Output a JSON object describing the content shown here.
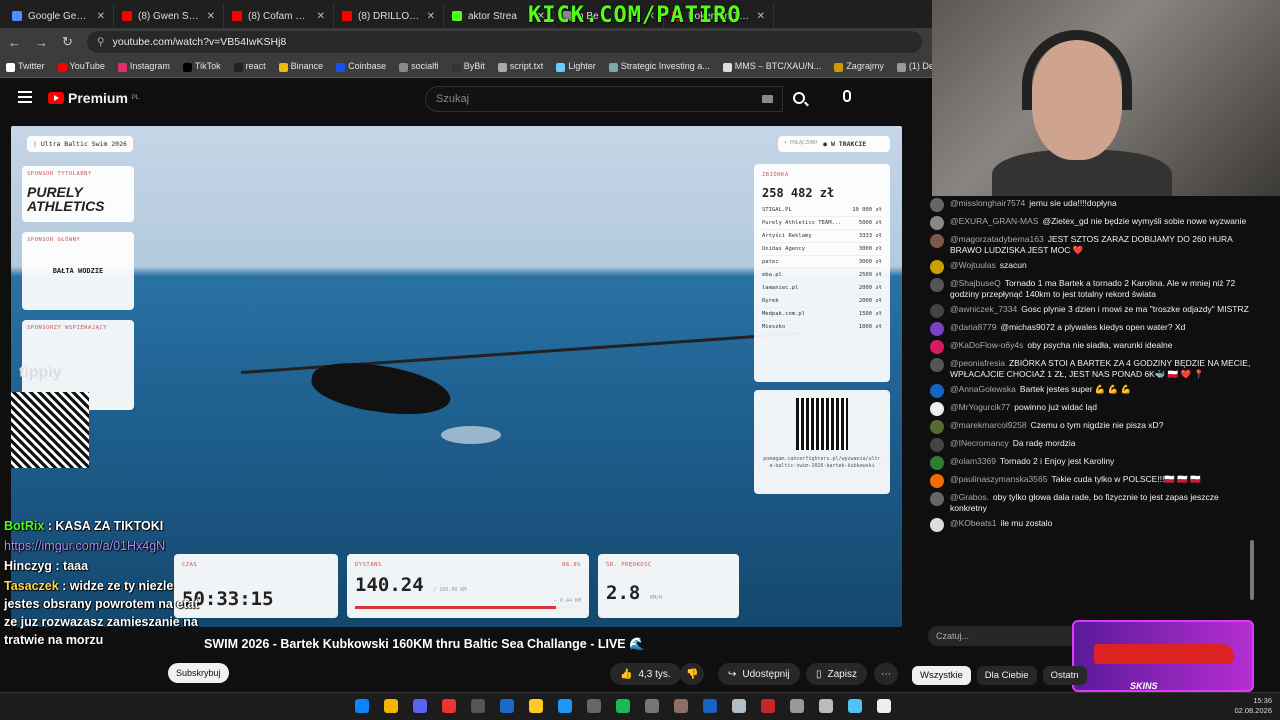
{
  "tabs": [
    {
      "label": "Google Gemini",
      "color": "#4f8cff",
      "active": false
    },
    {
      "label": "(8) Gwen Stefani",
      "color": "#ff0000",
      "active": false
    },
    {
      "label": "(8) Cofam do tyłu",
      "color": "#ff0000",
      "active": false
    },
    {
      "label": "(8) DRILLOWIEC C",
      "color": "#ff0000",
      "active": false
    },
    {
      "label": "aktor Strea",
      "color": "#53fc18",
      "active": false
    },
    {
      "label": "h Be",
      "color": "#888",
      "active": false
    },
    {
      "label": "Pokemon TCG: M",
      "color": "#ff0000",
      "active": false
    }
  ],
  "overlay_title": "KICK.COM/PATIRO",
  "address": {
    "url": "youtube.com/watch?v=VB54IwKSHj8"
  },
  "bookmarks": [
    "Twitter",
    "YouTube",
    "Instagram",
    "TikTok",
    "react",
    "Binance",
    "Coinbase",
    "socialfi",
    "ByBit",
    "script.txt",
    "Lighter",
    "Strategic Investing a...",
    "MMS – BTC/XAU/N...",
    "Zagrajmy",
    "(1) DeFi Warhol on..."
  ],
  "header": {
    "brand": "Premium",
    "brand_region": "PL",
    "search_placeholder": "Szukaj"
  },
  "video": {
    "event_label": "Ultra Baltic Swim 2026",
    "status_connected": "• POŁĄCZONO",
    "status_live": "● W TRAKCIE",
    "sponsor_title_label": "SPONSOR TYTULARNY",
    "sponsor_title": "PURELY ATHLETICS",
    "sponsor_main_label": "SPONSOR GŁÓWNY",
    "sponsor_main": "BAŁTA WODZIE",
    "sponsors_support_label": "SPONSORZY WSPIERAJĄCY",
    "tippy": "tippiy",
    "fundraiser_label": "ZBIÓRKA",
    "fundraiser_total": "258 482 zł",
    "donors": [
      {
        "name": "STIGAL.PL",
        "amount": "10 000 zł"
      },
      {
        "name": "Purely Athletics TEAM...",
        "amount": "5000 zł"
      },
      {
        "name": "Artyści Reklamy",
        "amount": "3333 zł"
      },
      {
        "name": "Unidas Agency",
        "amount": "3000 zł"
      },
      {
        "name": "patec",
        "amount": "3000 zł"
      },
      {
        "name": "eba.pl",
        "amount": "2500 zł"
      },
      {
        "name": "lamaniec.pl",
        "amount": "2000 zł"
      },
      {
        "name": "Ryrek",
        "amount": "2000 zł"
      },
      {
        "name": "Medpak.com.pl",
        "amount": "1500 zł"
      },
      {
        "name": "Mieszko",
        "amount": "1000 zł"
      }
    ],
    "qr_url": "pomagam.cancerfighters.pl/wyzwania/ultra-baltic-swim-2026-bartek-kubkowski",
    "time_label": "CZAS",
    "time": "50:33:15",
    "distance_label": "DYSTANS",
    "distance": "140.24",
    "distance_max": "/ 160.00 KM",
    "distance_pct": "88.8%",
    "distance_pct_value": 0.888,
    "distance_remaining": "− 0.44 KM",
    "speed_label": "ŚR. PRĘDKOŚĆ",
    "speed": "2.8",
    "speed_unit": "KM/H"
  },
  "overlay_chat": [
    {
      "user": "BotRix",
      "text": ": KASA ZA TIKTOKI"
    },
    {
      "user": "",
      "text": "https://imgur.com/a/01Hx4gN"
    },
    {
      "user": "Hinczyg",
      "text": ": taaa"
    },
    {
      "user": "Tasaczek",
      "text": ": widze ze ty niezle jestes obsrany powrotem na etat ze juz rozwazasz zamieszanie na tratwie na morzu"
    }
  ],
  "video_title": "SWIM 2026 - Bartek Kubkowski 160KM thru Baltic Sea Challange - LIVE 🌊",
  "subscribe_label": "Subskrybuj",
  "actions": {
    "likes": "4,3 tys.",
    "share": "Udostępnij",
    "save": "Zapisz"
  },
  "chat_messages": [
    {
      "user": "@misslonghair7574",
      "text": "jemu sie uda!!!!dopłyna",
      "color": "#666"
    },
    {
      "user": "@EXURA_GRAN-MAS",
      "text": "@Zietex_gd nie będzie wymyśli sobie nowe wyzwanie",
      "color": "#888"
    },
    {
      "user": "@magorzatadyberna163",
      "text": "JEST SZTOS ZARAZ DOBIJAMY DO 260 HURA BRAWO LUDZISKA JEST MOC ❤️",
      "color": "#7b5a4a"
    },
    {
      "user": "@Wojtuulas",
      "text": "szacun",
      "color": "#caa000"
    },
    {
      "user": "@ShajbuseQ",
      "text": "Tornado 1 ma Bartek a tornado 2 Karolina. Ale w mniej niż 72 godziny przepłynąć 140km to jest totalny rekord świata",
      "color": "#555"
    },
    {
      "user": "@awniczek_7334",
      "text": "Gosc plynie 3 dzien i mowi ze ma \"troszke odjazdy\" MISTRZ",
      "color": "#444"
    },
    {
      "user": "@daria8779",
      "text": "@michas9072 a plywales kiedys open water? Xd",
      "color": "#7b3fc4"
    },
    {
      "user": "@KaDoFlow-o6y4s",
      "text": "oby psycha nie siadła, warunki idealne",
      "color": "#d81b60"
    },
    {
      "user": "@peoniafresia",
      "text": "ZBIÓRKA STOI A BARTEK ZA 4 GODZINY BĘDZIE NA MECIE, WPŁACAJCIE CHOCIAŻ 1 ZŁ, JEST NAS PONAD 6K🐳 🇵🇱 ❤️ 📍",
      "color": "#555"
    },
    {
      "user": "@AnnaGolewska",
      "text": "Bartek jestes super 💪 💪 💪",
      "color": "#1565c0"
    },
    {
      "user": "@MrYogurcik77",
      "text": "powinno już widać ląd",
      "color": "#eee"
    },
    {
      "user": "@marekmarcol9258",
      "text": "Czemu o tym nigdzie nie pisza xD?",
      "color": "#556b2f"
    },
    {
      "user": "@INecromancy",
      "text": "Da radę mordzia",
      "color": "#444"
    },
    {
      "user": "@olam3369",
      "text": "Tornado 2 i Enjoy jest Karoliny",
      "color": "#2e7d32"
    },
    {
      "user": "@paulinaszymanska3565",
      "text": "Takie cuda tylko w POLSCE!!!🇵🇱 🇵🇱 🇵🇱",
      "color": "#ef6c00"
    },
    {
      "user": "@Grabos.",
      "text": "oby tylko głowa dala rade, bo fizycznie to jest zapas jeszcze konkretny",
      "color": "#666"
    },
    {
      "user": "@KObeats1",
      "text": "ile mu zostalo",
      "color": "#ddd"
    }
  ],
  "chat_input_placeholder": "Czatuj...",
  "chips": [
    "Wszystkie",
    "Dla Ciebie",
    "Ostatn"
  ],
  "promo_label": "SKINS",
  "tray": {
    "time": "15:36",
    "date": "02.08.2026"
  }
}
